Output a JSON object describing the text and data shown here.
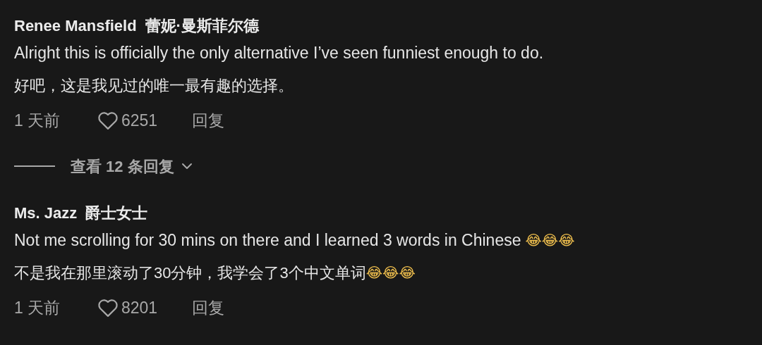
{
  "comments": [
    {
      "author": "Renee Mansfield",
      "author_translation": "蕾妮·曼斯菲尔德",
      "text": "Alright this is officially the only alternative I’ve seen funniest enough to do.",
      "translation": "好吧，这是我见过的唯一最有趣的选择。",
      "time": "1 天前",
      "likes": "6251",
      "reply": "回复",
      "view_replies": "查看 12 条回复"
    },
    {
      "author": "Ms. Jazz",
      "author_translation": "爵士女士",
      "text": "Not me scrolling for 30 mins on there and I learned 3 words in Chinese",
      "text_emoji": "😂😂😂",
      "translation": "不是我在那里滚动了30分钟，我学会了3个中文单词",
      "translation_emoji": "😂😂😂",
      "time": "1 天前",
      "likes": "8201",
      "reply": "回复"
    }
  ]
}
